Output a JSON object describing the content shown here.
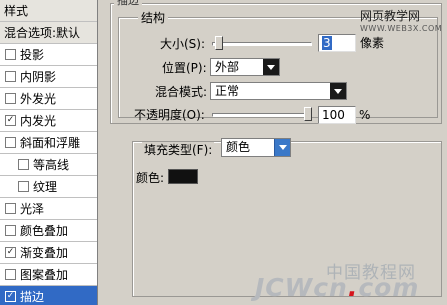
{
  "styles_panel": {
    "header": "样式",
    "blend_options": "混合选项:默认",
    "items": [
      {
        "label": "投影",
        "checked": false,
        "sub": false
      },
      {
        "label": "内阴影",
        "checked": false,
        "sub": false
      },
      {
        "label": "外发光",
        "checked": false,
        "sub": false
      },
      {
        "label": "内发光",
        "checked": true,
        "sub": false
      },
      {
        "label": "斜面和浮雕",
        "checked": false,
        "sub": false
      },
      {
        "label": "等高线",
        "checked": false,
        "sub": true
      },
      {
        "label": "纹理",
        "checked": false,
        "sub": true
      },
      {
        "label": "光泽",
        "checked": false,
        "sub": false
      },
      {
        "label": "颜色叠加",
        "checked": false,
        "sub": false
      },
      {
        "label": "渐变叠加",
        "checked": true,
        "sub": false
      },
      {
        "label": "图案叠加",
        "checked": false,
        "sub": false
      },
      {
        "label": "描边",
        "checked": true,
        "sub": false,
        "selected": true
      }
    ]
  },
  "stroke": {
    "section_title": "描边",
    "structure_title": "结构",
    "size_label": "大小(S):",
    "size_value": "3",
    "size_unit": "像素",
    "size_slider_level": 0.03,
    "position_label": "位置(P):",
    "position_value": "外部",
    "blend_mode_label": "混合模式:",
    "blend_mode_value": "正常",
    "opacity_label": "不透明度(O):",
    "opacity_value": "100",
    "opacity_unit": "%",
    "opacity_slider_level": 1.0,
    "fill_type_label": "填充类型(F):",
    "fill_type_value": "颜色",
    "color_label": "颜色:",
    "color_value": "#111111"
  },
  "watermarks": {
    "top_cn": "网页教学网",
    "top_url": "WWW.WEB3X.COM",
    "bottom_cn": "中国教程网",
    "bottom_prefix": "JCWcn",
    "bottom_dot": ".",
    "bottom_suffix": "com"
  },
  "colors": {
    "selection": "#316ac5",
    "dialog_bg": "#d4d0c8"
  }
}
